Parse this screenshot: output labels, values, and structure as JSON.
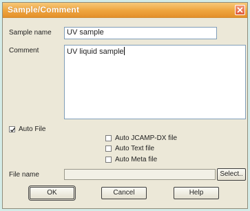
{
  "window": {
    "title": "Sample/Comment"
  },
  "sample_name": {
    "label": "Sample name",
    "value": "UV sample"
  },
  "comment": {
    "label": "Comment",
    "value": "UV liquid sample"
  },
  "auto_file": {
    "label": "Auto File",
    "checked": true
  },
  "options": [
    {
      "label": "Auto JCAMP-DX file",
      "checked": false
    },
    {
      "label": "Auto Text file",
      "checked": false
    },
    {
      "label": "Auto Meta file",
      "checked": false
    }
  ],
  "file_name": {
    "label": "File name",
    "value": ""
  },
  "buttons": {
    "select": "Select..",
    "ok": "OK",
    "cancel": "Cancel",
    "help": "Help"
  },
  "colors": {
    "titlebar": "#eea43e",
    "background": "#ece8d8"
  }
}
